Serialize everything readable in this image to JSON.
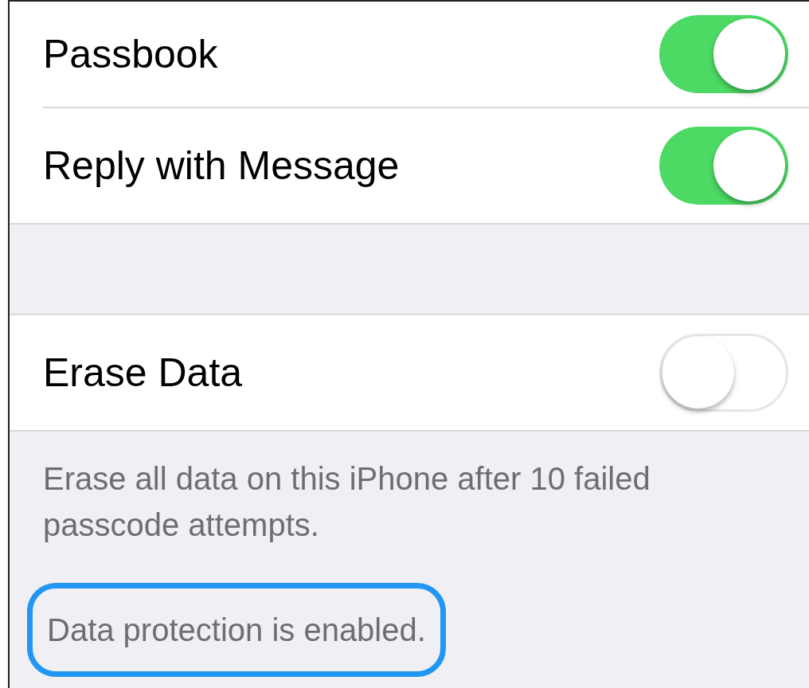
{
  "groups": [
    {
      "rows": [
        {
          "label": "Passbook",
          "on": true
        },
        {
          "label": "Reply with Message",
          "on": true
        }
      ]
    },
    {
      "rows": [
        {
          "label": "Erase Data",
          "on": false
        }
      ],
      "footer": "Erase all data on this iPhone after 10 failed passcode attempts."
    }
  ],
  "status_note": {
    "text": "Data protection is enabled.",
    "highlighted": true
  }
}
